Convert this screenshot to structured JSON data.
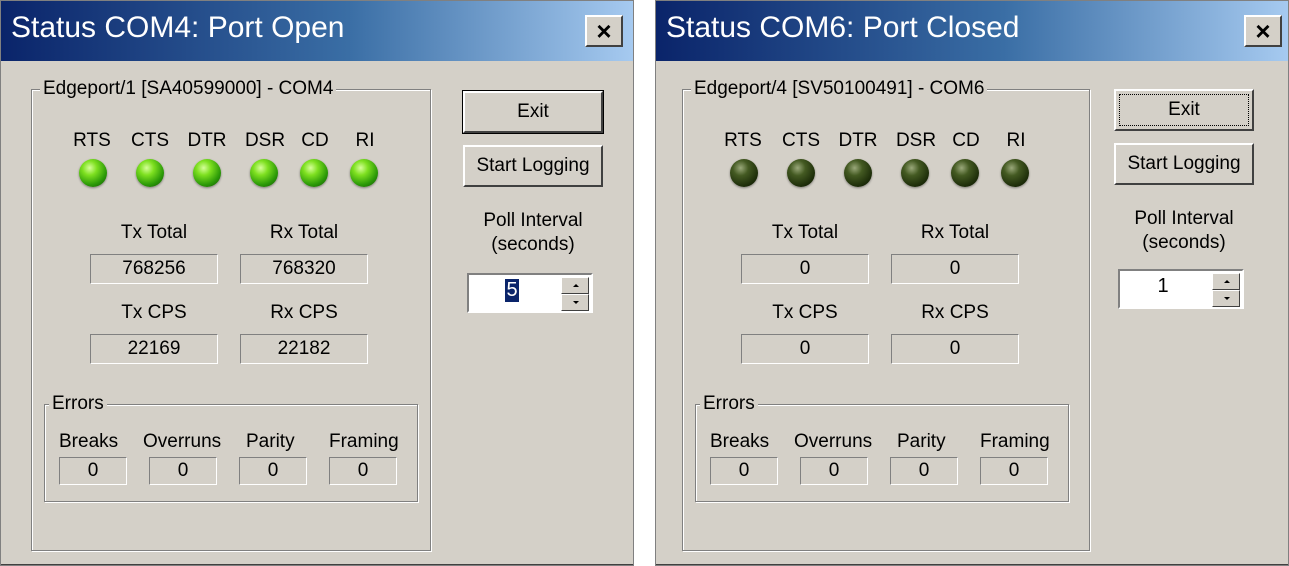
{
  "windows": [
    {
      "title": "Status COM4: Port Open",
      "close_glyph": "×",
      "group_label": "Edgeport/1 [SA40599000] - COM4",
      "signals": [
        "RTS",
        "CTS",
        "DTR",
        "DSR",
        "CD",
        "RI"
      ],
      "signal_state": "on",
      "tx_total_label": "Tx Total",
      "rx_total_label": "Rx Total",
      "tx_total": "768256",
      "rx_total": "768320",
      "tx_cps_label": "Tx CPS",
      "rx_cps_label": "Rx CPS",
      "tx_cps": "22169",
      "rx_cps": "22182",
      "errors_label": "Errors",
      "error_labels": [
        "Breaks",
        "Overruns",
        "Parity",
        "Framing"
      ],
      "error_values": [
        "0",
        "0",
        "0",
        "0"
      ],
      "exit_label": "Exit",
      "logging_label": "Start Logging",
      "poll_label_1": "Poll Interval",
      "poll_label_2": "(seconds)",
      "poll_value": "5"
    },
    {
      "title": "Status COM6: Port Closed",
      "close_glyph": "×",
      "group_label": "Edgeport/4 [SV50100491] - COM6",
      "signals": [
        "RTS",
        "CTS",
        "DTR",
        "DSR",
        "CD",
        "RI"
      ],
      "signal_state": "off",
      "tx_total_label": "Tx Total",
      "rx_total_label": "Rx Total",
      "tx_total": "0",
      "rx_total": "0",
      "tx_cps_label": "Tx CPS",
      "rx_cps_label": "Rx CPS",
      "tx_cps": "0",
      "rx_cps": "0",
      "errors_label": "Errors",
      "error_labels": [
        "Breaks",
        "Overruns",
        "Parity",
        "Framing"
      ],
      "error_values": [
        "0",
        "0",
        "0",
        "0"
      ],
      "exit_label": "Exit",
      "logging_label": "Start Logging",
      "poll_label_1": "Poll Interval",
      "poll_label_2": "(seconds)",
      "poll_value": "1"
    }
  ],
  "colors": {
    "led_on": "#2c9a08",
    "led_off": "#1e2e0a",
    "title_bar_start": "#0a246a",
    "title_bar_end": "#a6caf0",
    "dialog_face": "#d4d0c8"
  },
  "icons": {
    "close": "close-icon",
    "spin_up": "spin-up-arrow-icon",
    "spin_down": "spin-down-arrow-icon",
    "led": "status-led-icon"
  }
}
